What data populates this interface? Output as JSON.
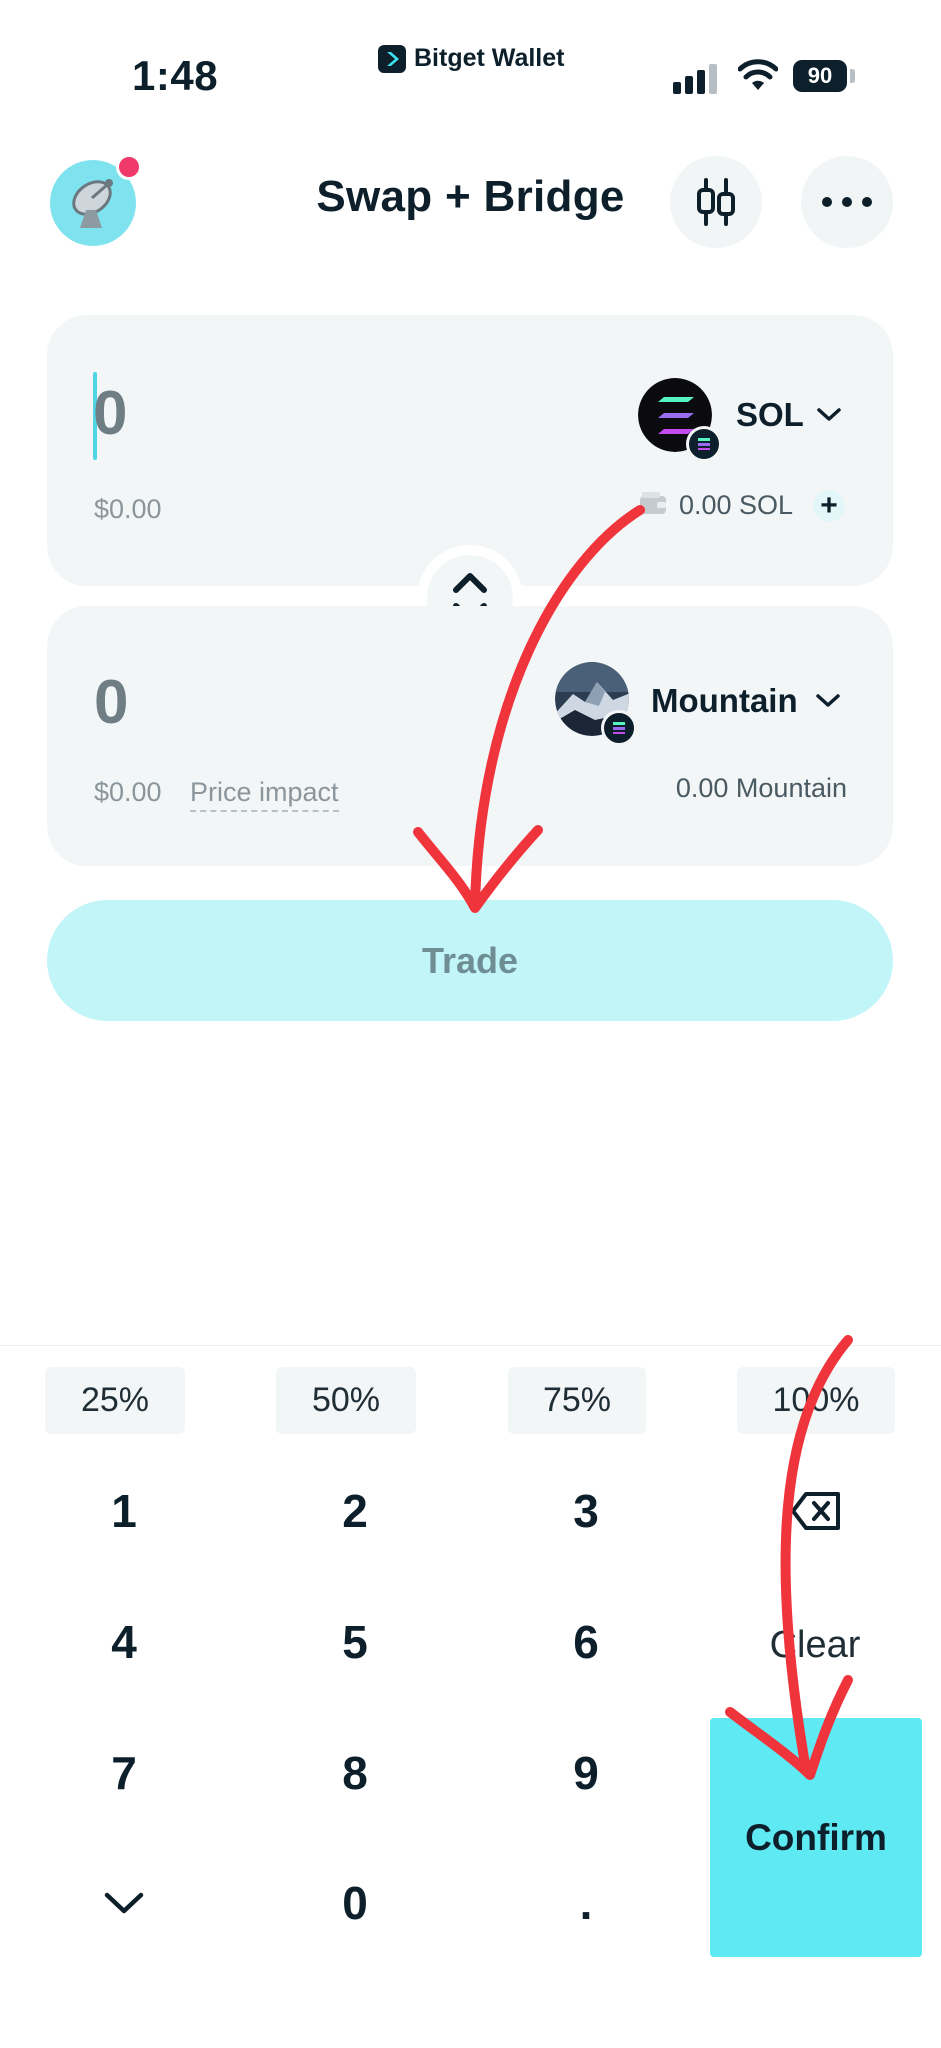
{
  "status_bar": {
    "time": "1:48",
    "app_name": "Bitget Wallet",
    "battery": "90"
  },
  "header": {
    "title": "Swap + Bridge"
  },
  "from_card": {
    "amount": "0",
    "usd_value": "$0.00",
    "token": "SOL",
    "balance": "0.00 SOL",
    "add_label": "+"
  },
  "to_card": {
    "amount": "0",
    "usd_value": "$0.00",
    "price_impact_label": "Price impact",
    "token": "Mountain",
    "balance": "0.00 Mountain"
  },
  "trade_button": {
    "label": "Trade"
  },
  "percent_buttons": [
    "25%",
    "50%",
    "75%",
    "100%"
  ],
  "keypad": {
    "keys": [
      "1",
      "2",
      "3",
      "4",
      "5",
      "6",
      "7",
      "8",
      "9",
      "0",
      "."
    ],
    "clear_label": "Clear",
    "confirm_label": "Confirm"
  },
  "colors": {
    "accent": "#5fe9f3",
    "trade_disabled": "#c2f5f8",
    "annotation_arrow": "#f0343c"
  }
}
